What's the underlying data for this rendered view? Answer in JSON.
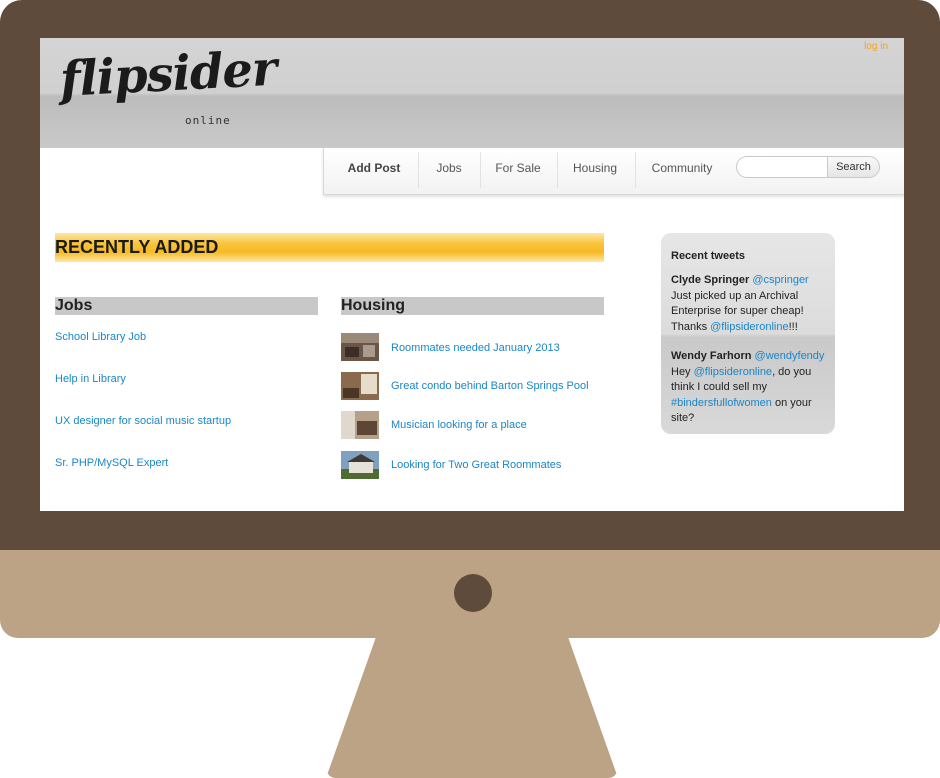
{
  "site": {
    "logo": "flipsider",
    "logo_sub": "online",
    "login_label": "log in"
  },
  "nav": {
    "items": [
      "Add Post",
      "Jobs",
      "For Sale",
      "Housing",
      "Community"
    ],
    "search_placeholder": "",
    "search_button": "Search"
  },
  "main": {
    "recent_title": "RECENTLY ADDED",
    "jobs": {
      "heading": "Jobs",
      "items": [
        "School Library Job",
        "Help in Library",
        "UX designer for social music startup",
        "Sr. PHP/MySQL Expert"
      ]
    },
    "housing": {
      "heading": "Housing",
      "items": [
        "Roommates needed January 2013",
        "Great condo behind Barton Springs Pool",
        "Musician looking for a place",
        "Looking for Two Great Roommates"
      ]
    }
  },
  "tweets": {
    "title": "Recent tweets",
    "items": [
      {
        "name": "Clyde Springer",
        "handle": "@cspringer",
        "text_1": "Just picked up an Archival Enterprise for super cheap! Thanks ",
        "mention": "@flipsideronline",
        "text_2": "!!!"
      },
      {
        "name": "Wendy Farhorn",
        "handle": "@wendyfendy",
        "text_1": "Hey ",
        "mention": "@flipsideronline",
        "text_2": ", do you think I could sell my ",
        "hashtag": "#bindersfullofwomen",
        "text_3": " on your site?"
      }
    ]
  },
  "colors": {
    "bezel": "#5e4b3c",
    "chin": "#bca386",
    "link": "#1a86c7",
    "accent": "#f7b923",
    "login": "#f5a21c"
  }
}
